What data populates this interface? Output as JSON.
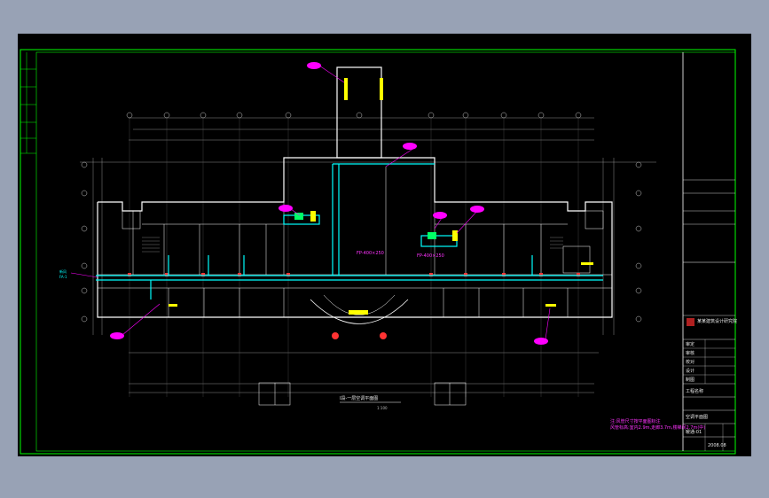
{
  "drawing": {
    "title_stamp": "Ⅰ段-一层空调平面图",
    "scale_note": "1:100",
    "bottom_note_line1": "注:风管尺寸按平面图标注",
    "bottom_note_line2": "风管标高:室内2.9m,走廊3.7m,楼梯间2.7m(中)",
    "duct_label_1": "FP-400×250",
    "duct_label_2": "FP-400×250",
    "left_tag_1": "新风",
    "left_tag_2": "FA-1"
  },
  "title_block": {
    "project_label": "工程名称",
    "company": "某某建筑设计研究院",
    "sheet_title": "空调平面图",
    "drawing_no": "暖通-01",
    "rows": [
      "审定",
      "审核",
      "校对",
      "设计",
      "制图"
    ],
    "date": "2008.08"
  },
  "colors": {
    "background": "#000000",
    "frame": "#00ff00",
    "walls": "#ffffff",
    "grid": "#b0b0b0",
    "duct": "#00ffff",
    "annotation": "#ff00ff",
    "equipment": "#ffff00",
    "columns": "#ff3333"
  }
}
